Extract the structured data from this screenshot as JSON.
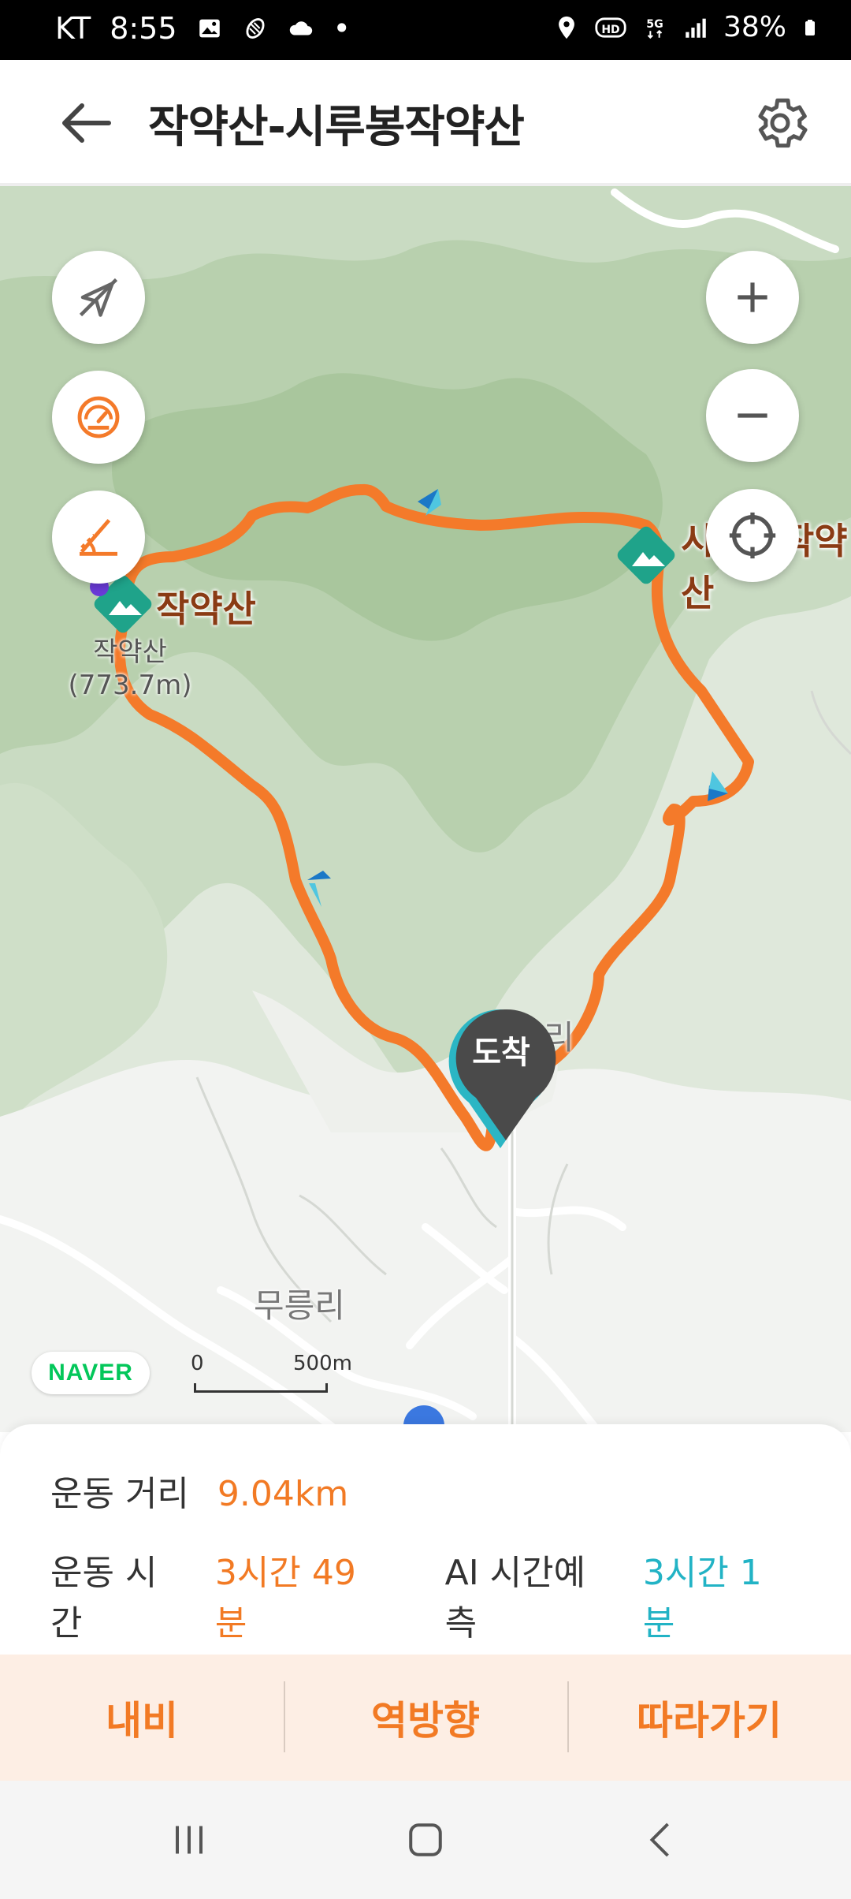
{
  "status_bar": {
    "carrier": "KT",
    "time": "8:55",
    "dot": "•",
    "battery": "38%",
    "icons": [
      "image-icon",
      "activity-icon",
      "cloud-icon",
      "location-icon",
      "hd-icon",
      "5g-icon",
      "signal-icon",
      "battery-icon"
    ]
  },
  "header": {
    "title": "작약산-시루봉작약산",
    "back_icon": "arrow-left-icon",
    "settings_icon": "gear-icon"
  },
  "map": {
    "labels": {
      "peak_left_title": "작약산",
      "peak_left_name": "작약산",
      "peak_left_elev": "(773.7m)",
      "peak_right_title": "시루봉작약산",
      "village_1": "무릉리",
      "village_2": "리",
      "arrive": "도착"
    },
    "scale": {
      "zero": "0",
      "distance": "500m"
    },
    "brand": "NAVER",
    "buttons": [
      "direction-off-icon",
      "speedometer-icon",
      "slope-icon",
      "zoom-in-icon",
      "zoom-out-icon",
      "locate-icon"
    ],
    "colors": {
      "route": "#f47a2a",
      "peak": "#1fa38a",
      "pin": "#4a4a4a"
    }
  },
  "info": {
    "distance_label": "운동 거리",
    "distance_value": "9.04km",
    "time_label": "운동 시간",
    "time_value": "3시간 49분",
    "ai_label": "AI 시간예측",
    "ai_value": "3시간 1분"
  },
  "actions": {
    "navigate": "내비",
    "reverse": "역방향",
    "follow": "따라가기"
  },
  "nav_bar": [
    "recent-apps-icon",
    "home-icon",
    "back-icon"
  ]
}
